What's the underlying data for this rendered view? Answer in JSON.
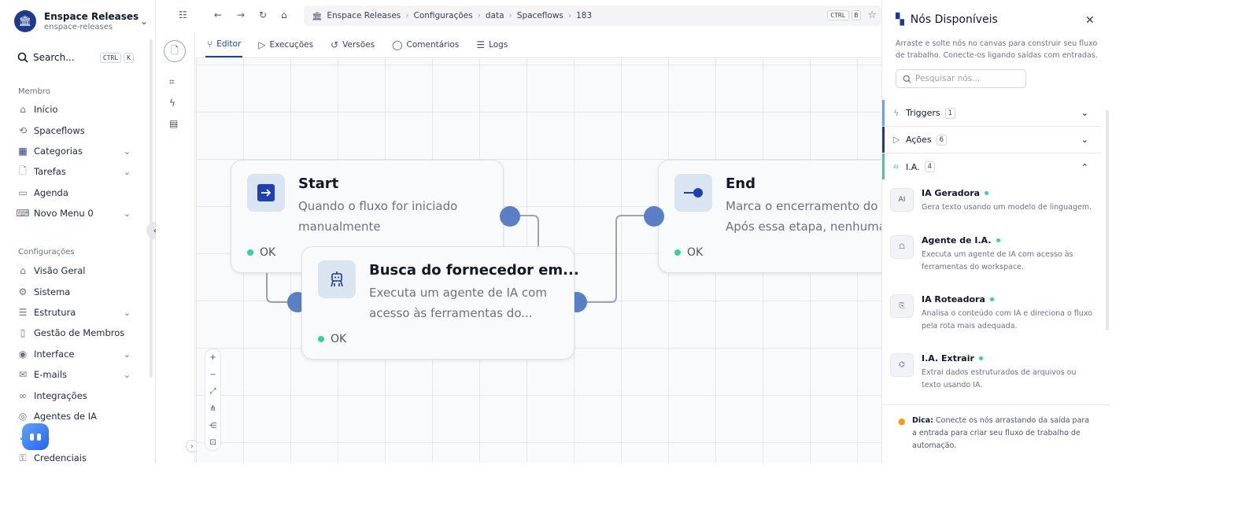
{
  "workspace": {
    "name": "Enspace Releases",
    "slug": "enspace-releases"
  },
  "search": {
    "label": "Search...",
    "kbd": [
      "CTRL",
      "K"
    ]
  },
  "sidebar": {
    "section_member": "Membro",
    "member_items": [
      {
        "label": "Início",
        "icon": "home-icon",
        "chevron": false
      },
      {
        "label": "Spaceflows",
        "icon": "flow-icon",
        "chevron": false
      },
      {
        "label": "Categorias",
        "icon": "grid-icon",
        "chevron": true
      },
      {
        "label": "Tarefas",
        "icon": "file-icon",
        "chevron": true
      },
      {
        "label": "Agenda",
        "icon": "calendar-icon",
        "chevron": false
      },
      {
        "label": "Novo Menu 0",
        "icon": "keyboard-icon",
        "chevron": true
      }
    ],
    "section_settings": "Configurações",
    "settings_items": [
      {
        "label": "Visão Geral",
        "icon": "building-icon",
        "chevron": false
      },
      {
        "label": "Sistema",
        "icon": "gear-icon",
        "chevron": false
      },
      {
        "label": "Estrutura",
        "icon": "database-icon",
        "chevron": true
      },
      {
        "label": "Gestão de Membros",
        "icon": "badge-icon",
        "chevron": false
      },
      {
        "label": "Interface",
        "icon": "compass-icon",
        "chevron": true
      },
      {
        "label": "E-mails",
        "icon": "mail-icon",
        "chevron": true
      },
      {
        "label": "Integrações",
        "icon": "link-icon",
        "chevron": false
      },
      {
        "label": "Agentes de IA",
        "icon": "cpu-icon",
        "chevron": false
      },
      {
        "label": "s",
        "icon": "check-icon",
        "chevron": false
      },
      {
        "label": "Credenciais",
        "icon": "key-icon",
        "chevron": false
      }
    ]
  },
  "breadcrumb": [
    "Enspace Releases",
    "Configurações",
    "data",
    "Spaceflows",
    "183"
  ],
  "shortcut": [
    "CTRL",
    "B"
  ],
  "tabs": [
    {
      "label": "Editor",
      "active": true,
      "icon": "branch-icon"
    },
    {
      "label": "Execuções",
      "active": false,
      "icon": "play-icon"
    },
    {
      "label": "Versões",
      "active": false,
      "icon": "history-icon"
    },
    {
      "label": "Comentários",
      "active": false,
      "icon": "comment-icon"
    },
    {
      "label": "Logs",
      "active": false,
      "icon": "logs-icon"
    }
  ],
  "nodes": {
    "start": {
      "title": "Start",
      "desc_line1": "Quando o fluxo for iniciado",
      "desc_line2": "manualmente",
      "status": "OK"
    },
    "agent": {
      "title": "Busca do fornecedor em...",
      "desc_line1": "Executa um agente de IA com",
      "desc_line2": "acesso às ferramentas do...",
      "status": "OK"
    },
    "end": {
      "title": "End",
      "desc_line1": "Marca o encerramento do fl",
      "desc_line2": "Após essa etapa, nenhuma a",
      "status": "OK"
    }
  },
  "zoom_controls": [
    "+",
    "−",
    "⤢",
    "⋔",
    "⋲",
    "⊡"
  ],
  "panel": {
    "title": "Nós Disponíveis",
    "subtitle": "Arraste e solte nós no canvas para construir seu fluxo de trabalho. Conecte-os ligando saídas com entradas.",
    "search_placeholder": "Pesquisar nós...",
    "categories": [
      {
        "label": "Triggers",
        "count": "1",
        "color": "#60a5fa",
        "expanded": false
      },
      {
        "label": "Ações",
        "count": "6",
        "color": "#1e3a8a",
        "expanded": false
      },
      {
        "label": "I.A.",
        "count": "4",
        "color": "#34d399",
        "expanded": true
      }
    ],
    "items": [
      {
        "name": "IA Geradora",
        "icon": "ai-icon",
        "desc": "Gera texto usando um modelo de linguagem."
      },
      {
        "name": "Agente de I.A.",
        "icon": "robot-icon",
        "desc": "Executa um agente de IA com acesso às ferramentas do workspace."
      },
      {
        "name": "IA Roteadora",
        "icon": "route-icon",
        "desc": "Analisa o conteúdo com IA e direciona o fluxo pela rota mais adequada."
      },
      {
        "name": "I.A. Extrair",
        "icon": "extract-icon",
        "desc": "Extrai dados estruturados de arquivos ou texto usando IA."
      }
    ],
    "tip_label": "Dica:",
    "tip_text": "Conecte os nós arrastando da saída para a entrada para criar seu fluxo de trabalho de automação."
  },
  "colors": {
    "accent": "#1e40af",
    "port": "#5b7fc4",
    "ok": "#34d399"
  }
}
